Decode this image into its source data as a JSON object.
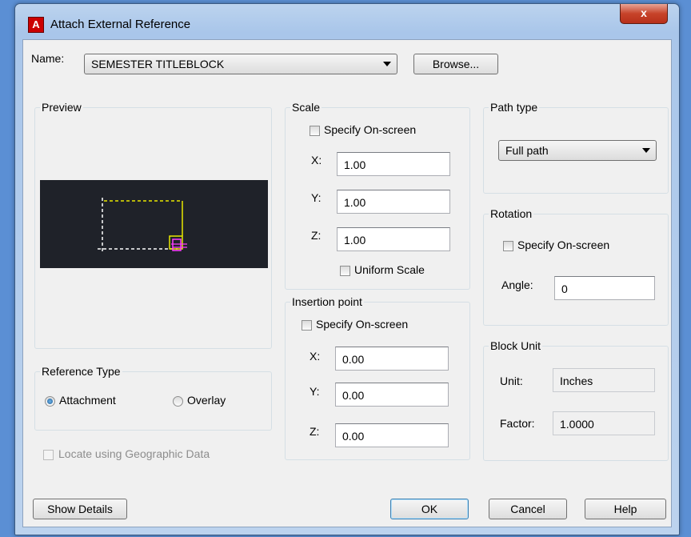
{
  "window": {
    "title": "Attach External Reference",
    "close_glyph": "x"
  },
  "name_field": {
    "label": "Name:",
    "value": "SEMESTER TITLEBLOCK"
  },
  "browse_label": "Browse...",
  "preview": {
    "title": "Preview"
  },
  "reference_type": {
    "title": "Reference Type",
    "attachment": "Attachment",
    "overlay": "Overlay",
    "selected": "Attachment"
  },
  "geographic": {
    "label": "Locate using Geographic Data",
    "checked": false,
    "enabled": false
  },
  "scale": {
    "title": "Scale",
    "specify": "Specify On-screen",
    "x_label": "X:",
    "x": "1.00",
    "y_label": "Y:",
    "y": "1.00",
    "z_label": "Z:",
    "z": "1.00",
    "uniform": "Uniform Scale"
  },
  "insertion": {
    "title": "Insertion point",
    "specify": "Specify On-screen",
    "x_label": "X:",
    "x": "0.00",
    "y_label": "Y:",
    "y": "0.00",
    "z_label": "Z:",
    "z": "0.00"
  },
  "path_type": {
    "title": "Path type",
    "value": "Full path"
  },
  "rotation": {
    "title": "Rotation",
    "specify": "Specify On-screen",
    "angle_label": "Angle:",
    "angle": "0"
  },
  "block_unit": {
    "title": "Block Unit",
    "unit_label": "Unit:",
    "unit": "Inches",
    "factor_label": "Factor:",
    "factor": "1.0000"
  },
  "buttons": {
    "show_details": "Show Details",
    "ok": "OK",
    "cancel": "Cancel",
    "help": "Help"
  },
  "colors": {
    "title_gradient": "#a9c6ea",
    "close_red": "#c7432a",
    "preview_bg": "#1f2229",
    "preview_yellow": "#e8e800",
    "preview_magenta": "#ff3cff"
  }
}
